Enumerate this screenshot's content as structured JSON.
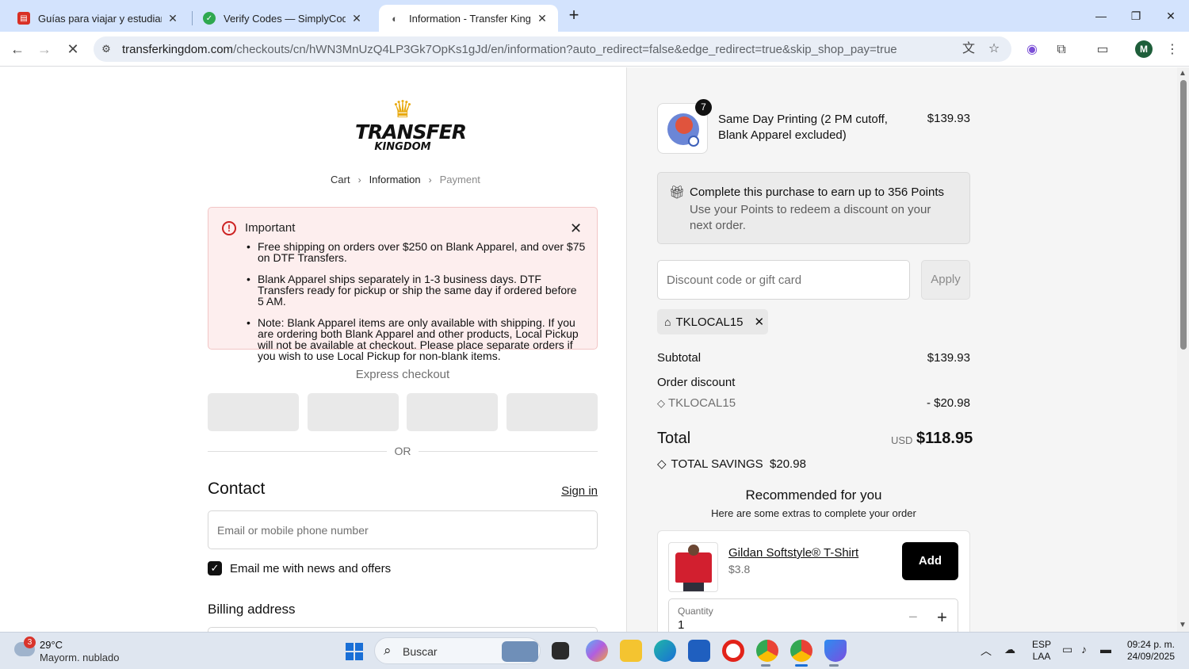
{
  "browser": {
    "tabs": [
      {
        "title": "Guías para viajar y estudiar en N",
        "favicon_color": "#d93025"
      },
      {
        "title": "Verify Codes — SimplyCodes",
        "favicon_color": "#2fa84f"
      },
      {
        "title": "Information - Transfer Kingdom",
        "favicon_color": "#5f6368",
        "active": true
      }
    ],
    "url_domain": "transferkingdom.com",
    "url_path": "/checkouts/cn/hWN3MnUzQ4LP3Gk7OpKs1gJd/en/information?auto_redirect=false&edge_redirect=true&skip_shop_pay=true",
    "profile_initial": "M"
  },
  "logo": {
    "line1": "TRANSFER",
    "line2": "KINGDOM"
  },
  "breadcrumb": {
    "cart": "Cart",
    "information": "Information",
    "payment": "Payment"
  },
  "notice": {
    "title": "Important",
    "items": [
      "Free shipping on orders over $250 on Blank Apparel, and over $75 on DTF Transfers.",
      "Blank Apparel ships separately in 1-3 business days. DTF Transfers ready for pickup or ship the same day if ordered before 5 AM.",
      "Note: Blank Apparel items are only available with shipping. If you are ordering both Blank Apparel and other products, Local Pickup will not be available at checkout. Please place separate orders if you wish to use Local Pickup for non-blank items."
    ]
  },
  "express": {
    "label": "Express checkout",
    "or": "OR"
  },
  "contact": {
    "heading": "Contact",
    "sign_in": "Sign in",
    "email_placeholder": "Email or mobile phone number",
    "newsletter_label": "Email me with news and offers",
    "newsletter_checked": true
  },
  "billing": {
    "heading": "Billing address"
  },
  "order": {
    "item": {
      "quantity": "7",
      "title": "Same Day Printing (2 PM cutoff, Blank Apparel excluded)",
      "price": "$139.93"
    },
    "points": {
      "title": "Complete this purchase to earn up to 356 Points",
      "subtitle": "Use your Points to redeem a discount on your next order."
    },
    "discount_placeholder": "Discount code or gift card",
    "apply_label": "Apply",
    "applied_code": "TKLOCAL15",
    "subtotal_label": "Subtotal",
    "subtotal_value": "$139.93",
    "order_discount_label": "Order discount",
    "discount_code": "TKLOCAL15",
    "discount_value": "- $20.98",
    "total_label": "Total",
    "currency": "USD",
    "total_value": "$118.95",
    "savings_label": "TOTAL SAVINGS",
    "savings_value": "$20.98"
  },
  "recommended": {
    "heading": "Recommended for you",
    "subheading": "Here are some extras to complete your order",
    "product": {
      "name": "Gildan Softstyle® T-Shirt",
      "price": "$3.8",
      "add_label": "Add"
    },
    "quantity_label": "Quantity",
    "quantity_value": "1"
  },
  "taskbar": {
    "weather_alerts": "3",
    "temperature": "29°C",
    "weather_desc": "Mayorm. nublado",
    "search_label": "Buscar",
    "lang1": "ESP",
    "lang2": "LAA",
    "time": "09:24 p. m.",
    "date": "24/09/2025"
  }
}
